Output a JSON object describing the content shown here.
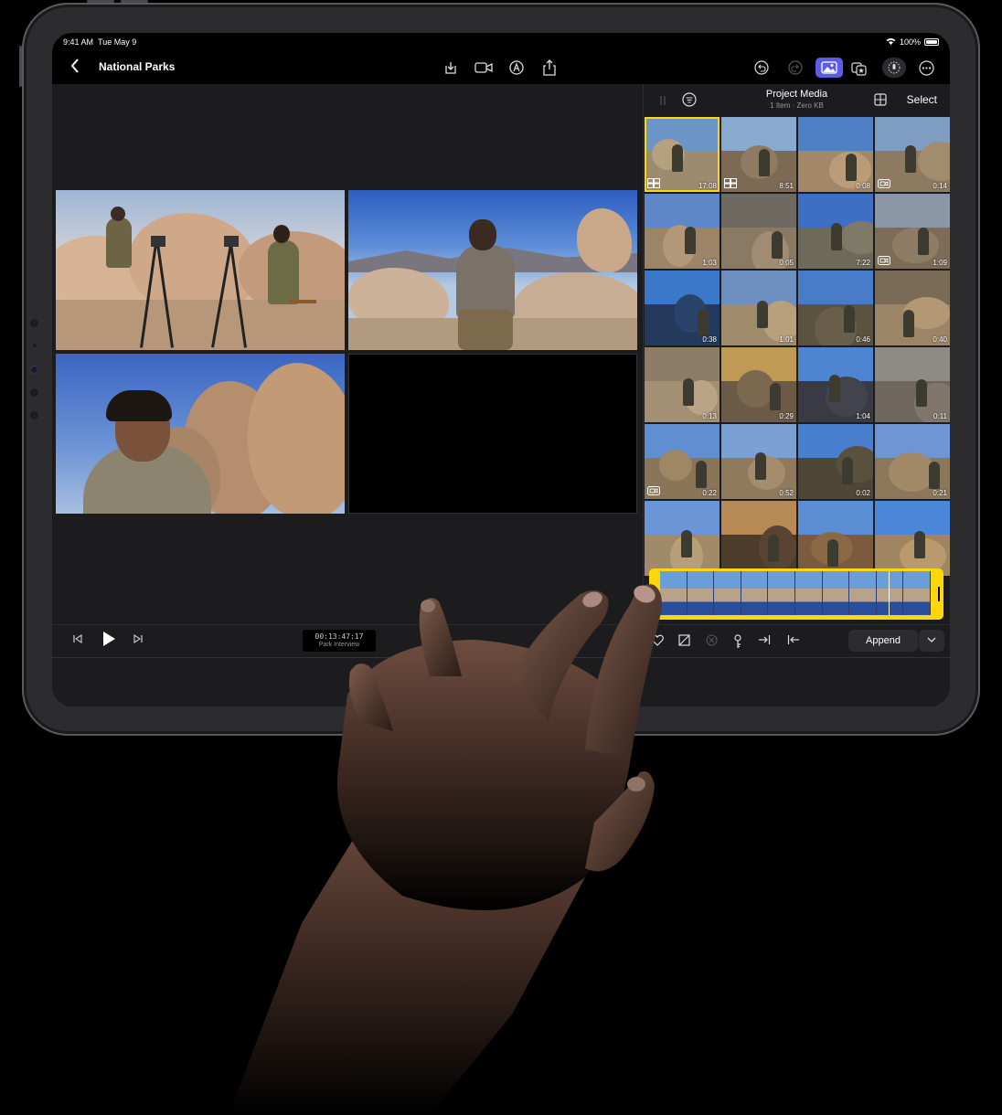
{
  "status_bar": {
    "time": "9:41 AM",
    "date": "Tue May 9",
    "battery": "100%"
  },
  "nav": {
    "title": "National Parks",
    "icons": [
      "import-icon",
      "camera-icon",
      "markup-icon",
      "share-icon",
      "undo-icon",
      "redo-icon",
      "photos-browser-icon",
      "effects-icon",
      "voiceover-icon",
      "more-icon"
    ]
  },
  "viewer": {
    "timecode": "00:13:47:17",
    "clip_name": "Park Interview"
  },
  "browser": {
    "title": "Project Media",
    "subtitle": "1 Item  ·  Zero KB",
    "select_label": "Select",
    "thumbnails": [
      {
        "duration": "17:08",
        "badge": "multicam",
        "selected": true,
        "sky": "#6b94c7",
        "ground": "#9d8b6f"
      },
      {
        "duration": "8:51",
        "badge": "multicam",
        "sky": "#8aa9cf",
        "ground": "#7d6a55"
      },
      {
        "duration": "0:08",
        "badge": "",
        "sky": "#4f7fc4",
        "ground": "#a28869"
      },
      {
        "duration": "0:14",
        "badge": "video",
        "sky": "#7f9dc3",
        "ground": "#8d7a60"
      },
      {
        "duration": "1:03",
        "badge": "",
        "sky": "#5d87c9",
        "ground": "#9b8468"
      },
      {
        "duration": "0:05",
        "badge": "",
        "sky": "#6e6a62",
        "ground": "#8a7a63"
      },
      {
        "duration": "7:22",
        "badge": "",
        "sky": "#3f6fc4",
        "ground": "#6e6a5a"
      },
      {
        "duration": "1:09",
        "badge": "video",
        "sky": "#8b97a6",
        "ground": "#7c6c58"
      },
      {
        "duration": "0:38",
        "badge": "",
        "sky": "#3c78c9",
        "ground": "#243a5c"
      },
      {
        "duration": "1:01",
        "badge": "",
        "sky": "#6d90c0",
        "ground": "#a18b6d"
      },
      {
        "duration": "0:46",
        "badge": "",
        "sky": "#4a7bc8",
        "ground": "#5b5240"
      },
      {
        "duration": "0:40",
        "badge": "",
        "sky": "#7a6b57",
        "ground": "#9c8466"
      },
      {
        "duration": "0:13",
        "badge": "",
        "sky": "#8d7c66",
        "ground": "#a38f74"
      },
      {
        "duration": "0:29",
        "badge": "",
        "sky": "#c09a55",
        "ground": "#6b5a45"
      },
      {
        "duration": "1:04",
        "badge": "",
        "sky": "#4f84d0",
        "ground": "#3a3a44"
      },
      {
        "duration": "0:11",
        "badge": "",
        "sky": "#8e8a85",
        "ground": "#6f675d"
      },
      {
        "duration": "0:22",
        "badge": "video",
        "sky": "#5f8ed3",
        "ground": "#8a7558"
      },
      {
        "duration": "0:52",
        "badge": "",
        "sky": "#7aa0d4",
        "ground": "#8f7a5e"
      },
      {
        "duration": "0:02",
        "badge": "",
        "sky": "#4a7fd0",
        "ground": "#4e4636"
      },
      {
        "duration": "0:21",
        "badge": "",
        "sky": "#6e96d2",
        "ground": "#8d775a"
      },
      {
        "duration": "",
        "badge": "",
        "sky": "#6a96d8",
        "ground": "#a08a6a"
      },
      {
        "duration": "",
        "badge": "",
        "sky": "#b78a56",
        "ground": "#4d3b2c"
      },
      {
        "duration": "",
        "badge": "",
        "sky": "#5c8ed6",
        "ground": "#7a5b3d"
      },
      {
        "duration": "",
        "badge": "",
        "sky": "#4c86d8",
        "ground": "#a08660"
      }
    ],
    "append_label": "Append"
  }
}
